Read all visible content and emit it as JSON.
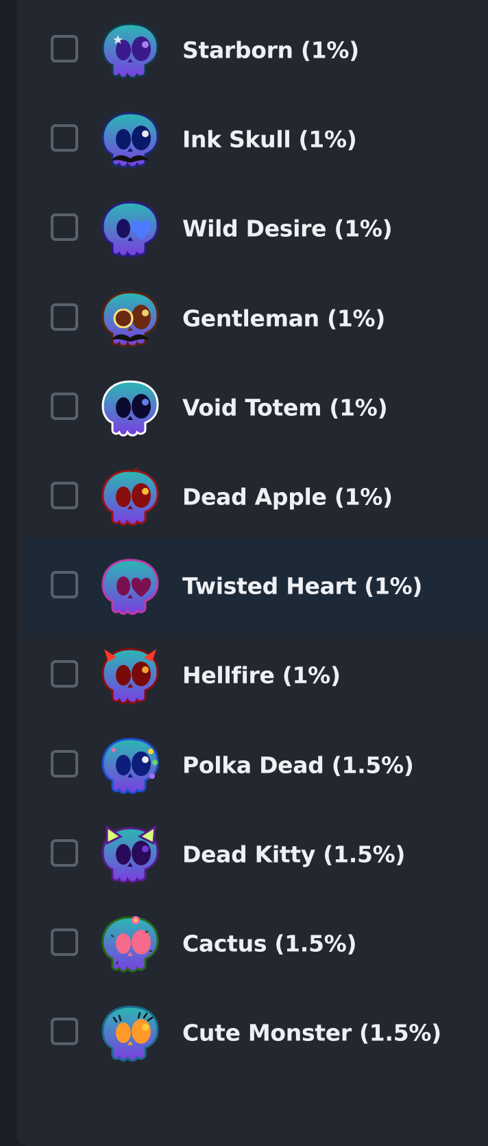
{
  "items": [
    {
      "label": "Starborn (1%)",
      "icon": "starborn-skull-icon",
      "colors": {
        "skull": "#2bb7b4",
        "skull2": "#7a3ee0",
        "eye": "#3a1a8c",
        "pupil": "#b98cf5",
        "outline": "#0f3b4a"
      },
      "style": "star"
    },
    {
      "label": "Ink Skull (1%)",
      "icon": "ink-skull-icon",
      "colors": {
        "skull": "#f3f6fb",
        "skull2": "#dfe6f5",
        "eye": "#0a1a6b",
        "pupil": "#ffffff",
        "outline": "#1b2a7a"
      },
      "style": "mustache"
    },
    {
      "label": "Wild Desire (1%)",
      "icon": "wild-desire-skull-icon",
      "colors": {
        "skull": "#5b3de6",
        "skull2": "#3f2ab8",
        "eye": "#1a1060",
        "pupil": "#4d7bff",
        "outline": "#2a1a8a"
      },
      "style": "heart-eye"
    },
    {
      "label": "Gentleman (1%)",
      "icon": "gentleman-skull-icon",
      "colors": {
        "skull": "#f08a3a",
        "skull2": "#c55a1f",
        "eye": "#6b2a10",
        "pupil": "#ffe27a",
        "outline": "#5a240c"
      },
      "style": "monocle-mustache"
    },
    {
      "label": "Void Totem (1%)",
      "icon": "void-totem-skull-icon",
      "colors": {
        "skull": "#2b1f8f",
        "skull2": "#1b1460",
        "eye": "#0c0a30",
        "pupil": "#6a8cff",
        "outline": "#ffffff"
      },
      "style": "plain"
    },
    {
      "label": "Dead Apple (1%)",
      "icon": "dead-apple-skull-icon",
      "colors": {
        "skull": "#ff3b2a",
        "skull2": "#d81f1f",
        "eye": "#8a0d0d",
        "pupil": "#ffd23a",
        "outline": "#a0121a"
      },
      "style": "apple"
    },
    {
      "label": "Twisted Heart (1%)",
      "icon": "twisted-heart-skull-icon",
      "colors": {
        "skull": "#ff8ce6",
        "skull2": "#f06ad4",
        "eye": "#7a1050",
        "pupil": "#7a1050",
        "outline": "#c03aa8"
      },
      "style": "heart-eye"
    },
    {
      "label": "Hellfire (1%)",
      "icon": "hellfire-skull-icon",
      "colors": {
        "skull": "#ff3a2a",
        "skull2": "#c41a1a",
        "eye": "#7a0a0a",
        "pupil": "#ffb23a",
        "outline": "#8a0d0d"
      },
      "style": "horns"
    },
    {
      "label": "Polka Dead (1.5%)",
      "icon": "polka-dead-skull-icon",
      "colors": {
        "skull": "#f4f6ff",
        "skull2": "#dfe4ff",
        "eye": "#0c1e7a",
        "pupil": "#ffffff",
        "outline": "#1b4fd1"
      },
      "style": "polka"
    },
    {
      "label": "Dead Kitty (1.5%)",
      "icon": "dead-kitty-skull-icon",
      "colors": {
        "skull": "#d8ff7a",
        "skull2": "#b6e84a",
        "eye": "#2a0a5a",
        "pupil": "#7a3ee0",
        "outline": "#5a1a8a"
      },
      "style": "cat-ears"
    },
    {
      "label": "Cactus (1.5%)",
      "icon": "cactus-skull-icon",
      "colors": {
        "skull": "#7ed13a",
        "skull2": "#56a92a",
        "eye": "#f56a8a",
        "pupil": "#f56a8a",
        "outline": "#2a6a1a"
      },
      "style": "cactus"
    },
    {
      "label": "Cute Monster (1.5%)",
      "icon": "cute-monster-skull-icon",
      "colors": {
        "skull": "#5ad8f0",
        "skull2": "#2ab4d8",
        "eye": "#ff9a2a",
        "pupil": "#ffd23a",
        "outline": "#1a6a8a"
      },
      "style": "lashes"
    }
  ],
  "hovered_index": 6
}
